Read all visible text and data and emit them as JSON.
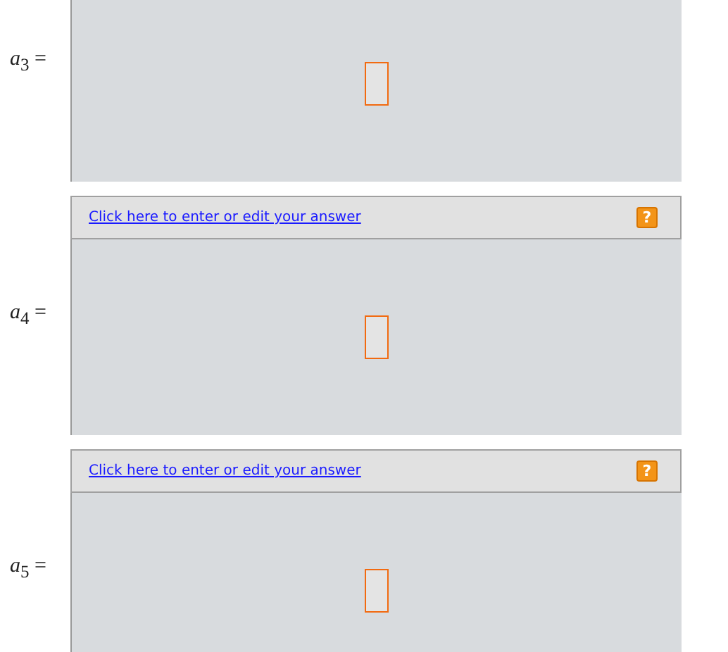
{
  "answers": [
    {
      "label": "*a*$_{3}$ ="
    },
    {
      "label": "*a*$_{4}$ =",
      "link": "Click here to enter or edit your answer",
      "help": "?"
    },
    {
      "label": "*a*$_{5}$ =",
      "link": "Click here to enter or edit your answer",
      "help": "?"
    }
  ]
}
